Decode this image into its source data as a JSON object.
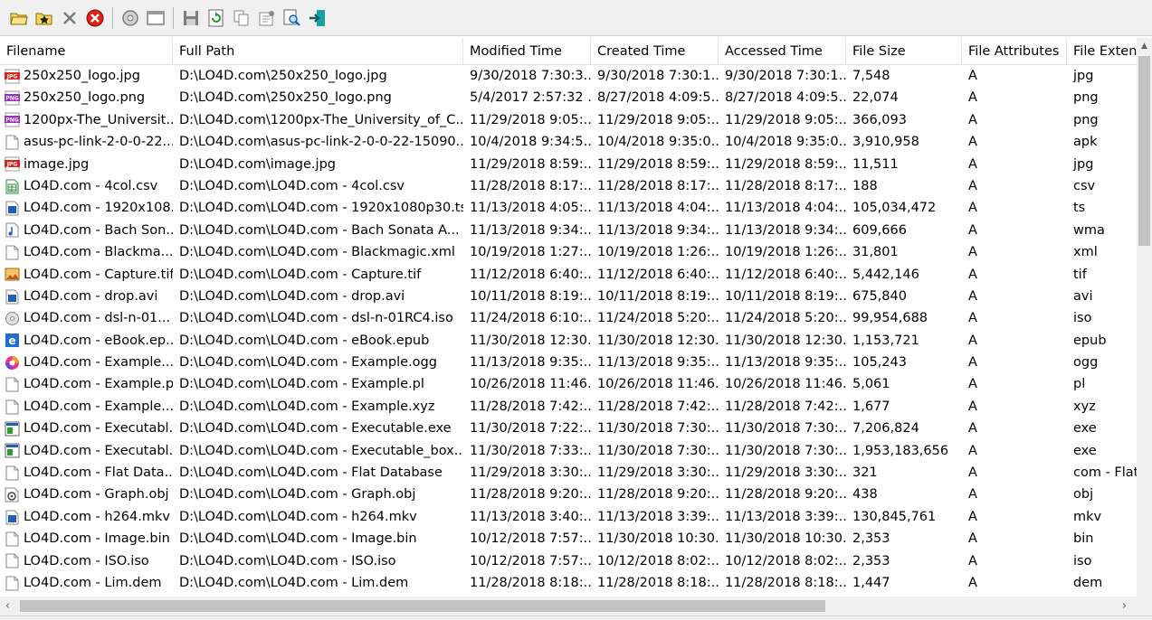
{
  "toolbar": {
    "buttons": [
      {
        "name": "open-folder-icon"
      },
      {
        "name": "open-favorites-icon"
      },
      {
        "name": "delete-x-icon"
      },
      {
        "name": "stop-icon"
      },
      {
        "name": "options-gear-icon"
      },
      {
        "name": "window-icon"
      },
      {
        "name": "save-icon"
      },
      {
        "name": "refresh-icon"
      },
      {
        "name": "copy-icon"
      },
      {
        "name": "properties-icon"
      },
      {
        "name": "find-icon"
      },
      {
        "name": "exit-icon"
      }
    ]
  },
  "columns": [
    {
      "label": "Filename"
    },
    {
      "label": "Full Path"
    },
    {
      "label": "Modified Time"
    },
    {
      "label": "Created Time"
    },
    {
      "label": "Accessed Time"
    },
    {
      "label": "File Size"
    },
    {
      "label": "File Attributes"
    },
    {
      "label": "File Extens"
    }
  ],
  "rows": [
    {
      "icon": "jpg",
      "cells": [
        "250x250_logo.jpg",
        "D:\\LO4D.com\\250x250_logo.jpg",
        "9/30/2018 7:30:3...",
        "9/30/2018 7:30:1...",
        "9/30/2018 7:30:1...",
        "7,548",
        "A",
        "jpg"
      ]
    },
    {
      "icon": "png",
      "cells": [
        "250x250_logo.png",
        "D:\\LO4D.com\\250x250_logo.png",
        "5/4/2017 2:57:32 ...",
        "8/27/2018 4:09:5...",
        "8/27/2018 4:09:5...",
        "22,074",
        "A",
        "png"
      ]
    },
    {
      "icon": "png",
      "cells": [
        "1200px-The_Universit...",
        "D:\\LO4D.com\\1200px-The_University_of_C...",
        "11/29/2018 9:05:...",
        "11/29/2018 9:05:...",
        "11/29/2018 9:05:...",
        "366,093",
        "A",
        "png"
      ]
    },
    {
      "icon": "blank",
      "cells": [
        "asus-pc-link-2-0-0-22...",
        "D:\\LO4D.com\\asus-pc-link-2-0-0-22-15090...",
        "10/4/2018 9:34:5...",
        "10/4/2018 9:35:0...",
        "10/4/2018 9:35:0...",
        "3,910,958",
        "A",
        "apk"
      ]
    },
    {
      "icon": "jpg",
      "cells": [
        "image.jpg",
        "D:\\LO4D.com\\image.jpg",
        "11/29/2018 8:59:...",
        "11/29/2018 8:59:...",
        "11/29/2018 8:59:...",
        "11,511",
        "A",
        "jpg"
      ]
    },
    {
      "icon": "csv",
      "cells": [
        "LO4D.com - 4col.csv",
        "D:\\LO4D.com\\LO4D.com - 4col.csv",
        "11/28/2018 8:17:...",
        "11/28/2018 8:17:...",
        "11/28/2018 8:17:...",
        "188",
        "A",
        "csv"
      ]
    },
    {
      "icon": "video",
      "cells": [
        "LO4D.com - 1920x108...",
        "D:\\LO4D.com\\LO4D.com - 1920x1080p30.ts",
        "11/13/2018 4:05:...",
        "11/13/2018 4:04:...",
        "11/13/2018 4:04:...",
        "105,034,472",
        "A",
        "ts"
      ]
    },
    {
      "icon": "audio",
      "cells": [
        "LO4D.com - Bach Son...",
        "D:\\LO4D.com\\LO4D.com - Bach Sonata A...",
        "11/13/2018 9:34:...",
        "11/13/2018 9:34:...",
        "11/13/2018 9:34:...",
        "609,666",
        "A",
        "wma"
      ]
    },
    {
      "icon": "blank",
      "cells": [
        "LO4D.com - Blackma...",
        "D:\\LO4D.com\\LO4D.com - Blackmagic.xml",
        "10/19/2018 1:27:...",
        "10/19/2018 1:26:...",
        "10/19/2018 1:26:...",
        "31,801",
        "A",
        "xml"
      ]
    },
    {
      "icon": "image",
      "cells": [
        "LO4D.com - Capture.tif",
        "D:\\LO4D.com\\LO4D.com - Capture.tif",
        "11/12/2018 6:40:...",
        "11/12/2018 6:40:...",
        "11/12/2018 6:40:...",
        "5,442,146",
        "A",
        "tif"
      ]
    },
    {
      "icon": "video",
      "cells": [
        "LO4D.com - drop.avi",
        "D:\\LO4D.com\\LO4D.com - drop.avi",
        "10/11/2018 8:19:...",
        "10/11/2018 8:19:...",
        "10/11/2018 8:19:...",
        "675,840",
        "A",
        "avi"
      ]
    },
    {
      "icon": "disc",
      "cells": [
        "LO4D.com - dsl-n-01...",
        "D:\\LO4D.com\\LO4D.com - dsl-n-01RC4.iso",
        "11/24/2018 6:10:...",
        "11/24/2018 5:20:...",
        "11/24/2018 5:20:...",
        "99,954,688",
        "A",
        "iso"
      ]
    },
    {
      "icon": "edge",
      "cells": [
        "LO4D.com - eBook.ep...",
        "D:\\LO4D.com\\LO4D.com - eBook.epub",
        "11/30/2018 12:30...",
        "11/30/2018 12:30...",
        "11/30/2018 12:30...",
        "1,153,721",
        "A",
        "epub"
      ]
    },
    {
      "icon": "ogg",
      "cells": [
        "LO4D.com - Example....",
        "D:\\LO4D.com\\LO4D.com - Example.ogg",
        "11/13/2018 9:35:...",
        "11/13/2018 9:35:...",
        "11/13/2018 9:35:...",
        "105,243",
        "A",
        "ogg"
      ]
    },
    {
      "icon": "blank",
      "cells": [
        "LO4D.com - Example.pl",
        "D:\\LO4D.com\\LO4D.com - Example.pl",
        "10/26/2018 11:46...",
        "10/26/2018 11:46...",
        "10/26/2018 11:46...",
        "5,061",
        "A",
        "pl"
      ]
    },
    {
      "icon": "blank",
      "cells": [
        "LO4D.com - Example....",
        "D:\\LO4D.com\\LO4D.com - Example.xyz",
        "11/28/2018 7:42:...",
        "11/28/2018 7:42:...",
        "11/28/2018 7:42:...",
        "1,677",
        "A",
        "xyz"
      ]
    },
    {
      "icon": "exe",
      "cells": [
        "LO4D.com - Executabl...",
        "D:\\LO4D.com\\LO4D.com - Executable.exe",
        "11/30/2018 7:22:...",
        "11/30/2018 7:30:...",
        "11/30/2018 7:30:...",
        "7,206,824",
        "A",
        "exe"
      ]
    },
    {
      "icon": "exe",
      "cells": [
        "LO4D.com - Executabl...",
        "D:\\LO4D.com\\LO4D.com - Executable_box...",
        "11/30/2018 7:33:...",
        "11/30/2018 7:30:...",
        "11/30/2018 7:30:...",
        "1,953,183,656",
        "A",
        "exe"
      ]
    },
    {
      "icon": "blank",
      "cells": [
        "LO4D.com - Flat Data...",
        "D:\\LO4D.com\\LO4D.com - Flat Database",
        "11/29/2018 3:30:...",
        "11/29/2018 3:30:...",
        "11/29/2018 3:30:...",
        "321",
        "A",
        "com - Flat"
      ]
    },
    {
      "icon": "obj",
      "cells": [
        "LO4D.com - Graph.obj",
        "D:\\LO4D.com\\LO4D.com - Graph.obj",
        "11/28/2018 9:20:...",
        "11/28/2018 9:20:...",
        "11/28/2018 9:20:...",
        "438",
        "A",
        "obj"
      ]
    },
    {
      "icon": "video",
      "cells": [
        "LO4D.com - h264.mkv",
        "D:\\LO4D.com\\LO4D.com - h264.mkv",
        "11/13/2018 3:40:...",
        "11/13/2018 3:39:...",
        "11/13/2018 3:39:...",
        "130,845,761",
        "A",
        "mkv"
      ]
    },
    {
      "icon": "blank",
      "cells": [
        "LO4D.com - Image.bin",
        "D:\\LO4D.com\\LO4D.com - Image.bin",
        "10/12/2018 7:57:...",
        "11/30/2018 10:30...",
        "11/30/2018 10:30...",
        "2,353",
        "A",
        "bin"
      ]
    },
    {
      "icon": "blank",
      "cells": [
        "LO4D.com - ISO.iso",
        "D:\\LO4D.com\\LO4D.com - ISO.iso",
        "10/12/2018 7:57:...",
        "10/12/2018 8:02:...",
        "10/12/2018 8:02:...",
        "2,353",
        "A",
        "iso"
      ]
    },
    {
      "icon": "blank",
      "cells": [
        "LO4D.com - Lim.dem",
        "D:\\LO4D.com\\LO4D.com - Lim.dem",
        "11/28/2018 8:18:...",
        "11/28/2018 8:18:...",
        "11/28/2018 8:18:...",
        "1,447",
        "A",
        "dem"
      ]
    }
  ],
  "colors": {
    "jpg": "#d6261e",
    "png": "#9b2cc4",
    "csv": "#2e8b3a",
    "video": "#1e5fb4",
    "toolbar_bg": "#f0f0f0"
  }
}
